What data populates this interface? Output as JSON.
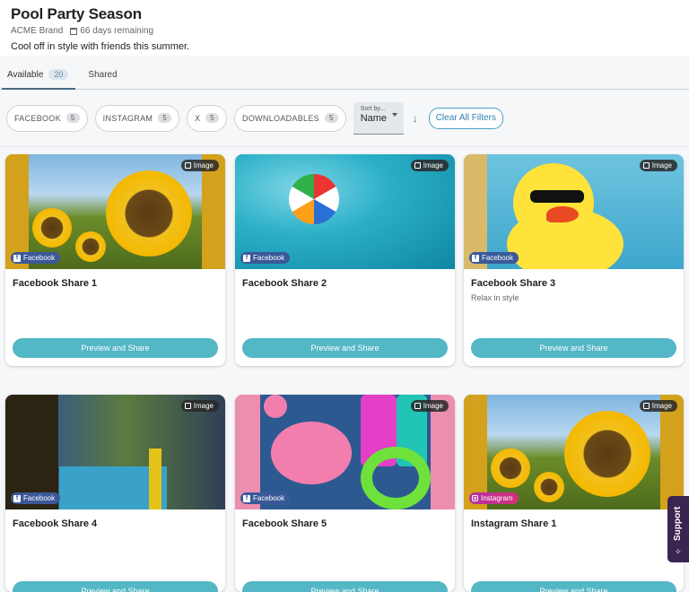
{
  "header": {
    "title": "Pool Party Season",
    "brand": "ACME Brand",
    "remaining": "66 days remaining",
    "description": "Cool off in style with friends this summer."
  },
  "tabs": [
    {
      "label": "Available",
      "count": "20",
      "active": true
    },
    {
      "label": "Shared",
      "active": false
    }
  ],
  "filters": {
    "chips": [
      {
        "label": "FACEBOOK",
        "count": "5"
      },
      {
        "label": "INSTAGRAM",
        "count": "5"
      },
      {
        "label": "X",
        "count": "5"
      },
      {
        "label": "DOWNLOADABLES",
        "count": "5"
      }
    ],
    "sort_label": "Sort by...",
    "sort_value": "Name",
    "clear_label": "Clear All Filters"
  },
  "cards": [
    {
      "title": "Facebook Share 1",
      "subtitle": "",
      "type": "Image",
      "platform": "Facebook",
      "button": "Preview and Share",
      "image": "sunflowers"
    },
    {
      "title": "Facebook Share 2",
      "subtitle": "",
      "type": "Image",
      "platform": "Facebook",
      "button": "Preview and Share",
      "image": "beach ball in pool"
    },
    {
      "title": "Facebook Share 3",
      "subtitle": "Relax in style",
      "type": "Image",
      "platform": "Facebook",
      "button": "Preview and Share",
      "image": "rubber duck float"
    },
    {
      "title": "Facebook Share 4",
      "subtitle": "",
      "type": "Image",
      "platform": "Facebook",
      "button": "Preview and Share",
      "image": "pool party"
    },
    {
      "title": "Facebook Share 5",
      "subtitle": "",
      "type": "Image",
      "platform": "Facebook",
      "button": "Preview and Share",
      "image": "flamingo floats"
    },
    {
      "title": "Instagram Share 1",
      "subtitle": "",
      "type": "Image",
      "platform": "Instagram",
      "button": "Preview and Share",
      "image": "sunflowers"
    }
  ],
  "support": {
    "label": "Support"
  },
  "colors": {
    "accent": "#54b7c6",
    "facebook": "#3b5998",
    "support_bg": "#3a2450"
  }
}
